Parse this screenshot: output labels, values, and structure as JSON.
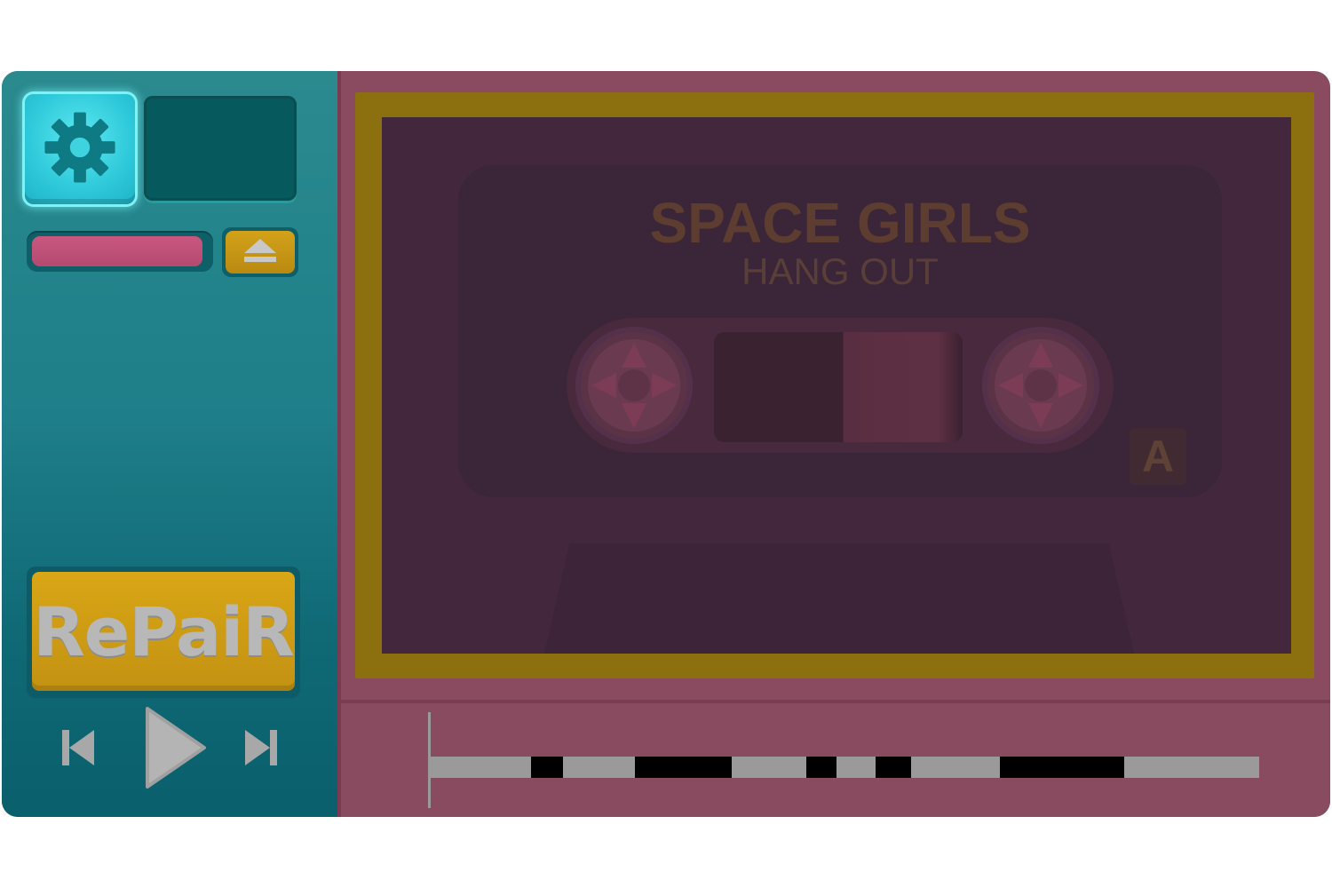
{
  "cassette": {
    "title": "SPACE GIRLS",
    "subtitle": "HANG OUT",
    "side": "A"
  },
  "controls": {
    "repair_label": "RePaiR",
    "settings_icon": "gear-icon",
    "eject_icon": "eject-icon",
    "previous_icon": "skip-previous-icon",
    "play_icon": "play-icon",
    "next_icon": "skip-next-icon",
    "volume_level": 0.97
  },
  "timeline": {
    "glitch_segments": [
      [
        0.122,
        0.161
      ],
      [
        0.247,
        0.364
      ],
      [
        0.454,
        0.49
      ],
      [
        0.538,
        0.581
      ],
      [
        0.687,
        0.837
      ]
    ]
  },
  "colors": {
    "panel_teal": "#1f7f8a",
    "settings_cyan": "#2ec9da",
    "repair_gold": "#d9a616",
    "tape_pink": "#894b5f",
    "frame_gold": "#8c7010",
    "glitch_black": "#000000",
    "track_gray": "#9a9a9a"
  }
}
